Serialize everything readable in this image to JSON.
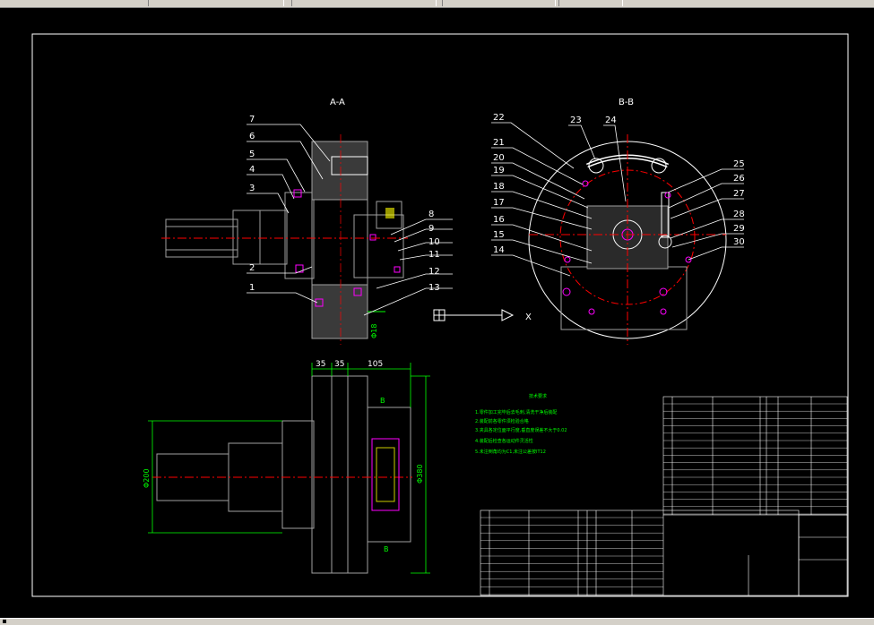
{
  "window": {
    "toolbar_segments": 6
  },
  "drawing": {
    "view_aa_title": "A-A",
    "view_bb_title": "B-B",
    "aa_callouts": [
      "7",
      "6",
      "5",
      "4",
      "3",
      "2",
      "1",
      "8",
      "9",
      "10",
      "11",
      "12",
      "13"
    ],
    "bb_callouts": [
      "22",
      "23",
      "24",
      "21",
      "20",
      "19",
      "18",
      "17",
      "16",
      "15",
      "14",
      "25",
      "26",
      "27",
      "28",
      "29",
      "30"
    ],
    "axis_label": "X",
    "dim_top": [
      "35",
      "35",
      "105"
    ],
    "dim_left": "Φ200",
    "dim_right": "Φ380",
    "dim_aa": "Φ18",
    "section_mark": "B",
    "notes_title": "技术要求",
    "notes_lines": [
      "1.零件加工完毕后去毛刺,清洗干净后装配",
      "2.装配前各零件须检验合格",
      "3.夹具各定位面平行度,垂直度误差不大于0.02",
      "4.装配后检查各运动件灵活性",
      "5.未注倒角均为C1,未注公差按IT12"
    ]
  },
  "colors": {
    "outline": "#ffffff",
    "part": "#a0a0a0",
    "center": "#ff0000",
    "green": "#00ff00",
    "magenta": "#ff00ff",
    "yellow": "#ffff00",
    "background": "#000000"
  }
}
